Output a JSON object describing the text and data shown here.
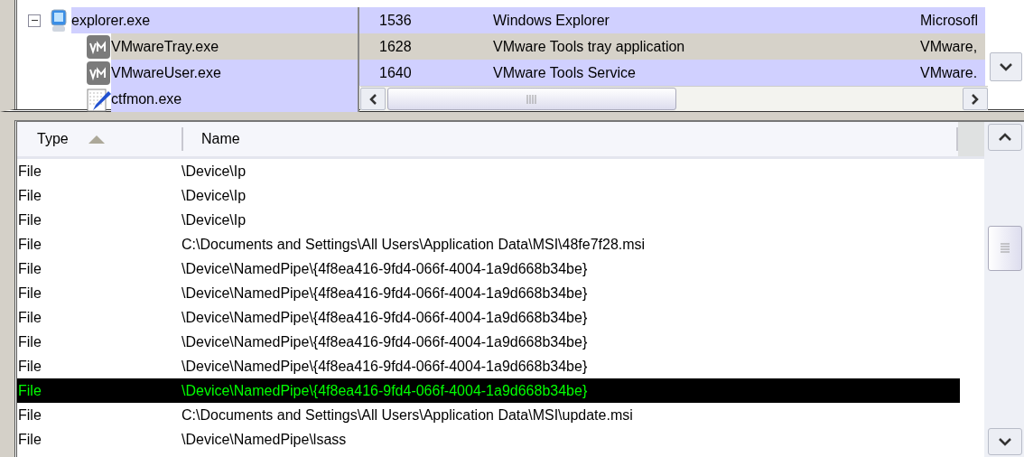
{
  "process_tree": {
    "processes": [
      {
        "name": "explorer.exe",
        "pid": "1536",
        "description": "Windows Explorer",
        "company": "Microsofl",
        "kind": "computer",
        "selected": false,
        "expanded": true,
        "children": [
          {
            "name": "VMwareTray.exe",
            "pid": "1628",
            "description": "VMware Tools tray application",
            "company": "VMware,",
            "kind": "vm",
            "selected": true
          },
          {
            "name": "VMwareUser.exe",
            "pid": "1640",
            "description": "VMware Tools Service",
            "company": "VMware.",
            "kind": "vm",
            "selected": false
          },
          {
            "name": "ctfmon.exe",
            "kind": "pen",
            "selected": false
          }
        ]
      }
    ]
  },
  "handles": {
    "columns": [
      {
        "label": "Type",
        "sorted": true
      },
      {
        "label": "Name",
        "sorted": false
      }
    ],
    "rows": [
      {
        "type": "File",
        "name": "\\Device\\Ip",
        "selected": false
      },
      {
        "type": "File",
        "name": "\\Device\\Ip",
        "selected": false
      },
      {
        "type": "File",
        "name": "\\Device\\Ip",
        "selected": false
      },
      {
        "type": "File",
        "name": "C:\\Documents and Settings\\All Users\\Application Data\\MSI\\48fe7f28.msi",
        "selected": false
      },
      {
        "type": "File",
        "name": "\\Device\\NamedPipe\\{4f8ea416-9fd4-066f-4004-1a9d668b34be}",
        "selected": false
      },
      {
        "type": "File",
        "name": "\\Device\\NamedPipe\\{4f8ea416-9fd4-066f-4004-1a9d668b34be}",
        "selected": false
      },
      {
        "type": "File",
        "name": "\\Device\\NamedPipe\\{4f8ea416-9fd4-066f-4004-1a9d668b34be}",
        "selected": false
      },
      {
        "type": "File",
        "name": "\\Device\\NamedPipe\\{4f8ea416-9fd4-066f-4004-1a9d668b34be}",
        "selected": false
      },
      {
        "type": "File",
        "name": "\\Device\\NamedPipe\\{4f8ea416-9fd4-066f-4004-1a9d668b34be}",
        "selected": false
      },
      {
        "type": "File",
        "name": "\\Device\\NamedPipe\\{4f8ea416-9fd4-066f-4004-1a9d668b34be}",
        "selected": true
      },
      {
        "type": "File",
        "name": "C:\\Documents and Settings\\All Users\\Application Data\\MSI\\update.msi",
        "selected": false
      },
      {
        "type": "File",
        "name": "\\Device\\NamedPipe\\lsass",
        "selected": false
      }
    ]
  }
}
